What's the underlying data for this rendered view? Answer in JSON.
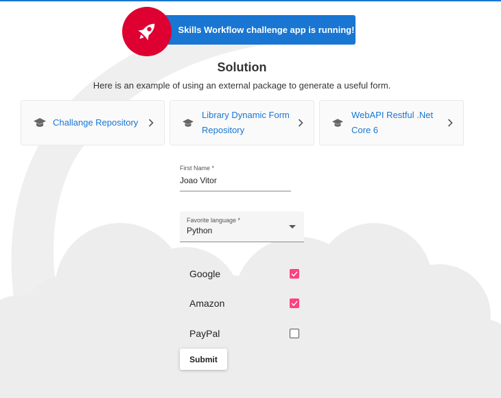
{
  "banner": {
    "text": "Skills Workflow challenge app is running!",
    "icon": "rocket-icon",
    "accent": "#1976d2",
    "icon_bg": "#dd0031"
  },
  "header": {
    "title": "Solution",
    "subtitle": "Here is an example of using an external package to generate a useful form."
  },
  "cards": [
    {
      "label": "Challange Repository",
      "icon": "graduation-cap-icon"
    },
    {
      "label": "Library Dynamic Form Repository",
      "icon": "graduation-cap-icon"
    },
    {
      "label": "WebAPI Restful .Net Core 6",
      "icon": "graduation-cap-icon"
    }
  ],
  "form": {
    "first_name": {
      "label": "First Name *",
      "value": "Joao Vitor"
    },
    "favorite_language": {
      "label": "Favorite language *",
      "value": "Python"
    },
    "checkboxes": [
      {
        "label": "Google",
        "checked": true
      },
      {
        "label": "Amazon",
        "checked": true
      },
      {
        "label": "PayPal",
        "checked": false
      }
    ],
    "submit_label": "Submit"
  },
  "colors": {
    "checkbox_checked": "#ff4081",
    "link": "#1976d2"
  }
}
